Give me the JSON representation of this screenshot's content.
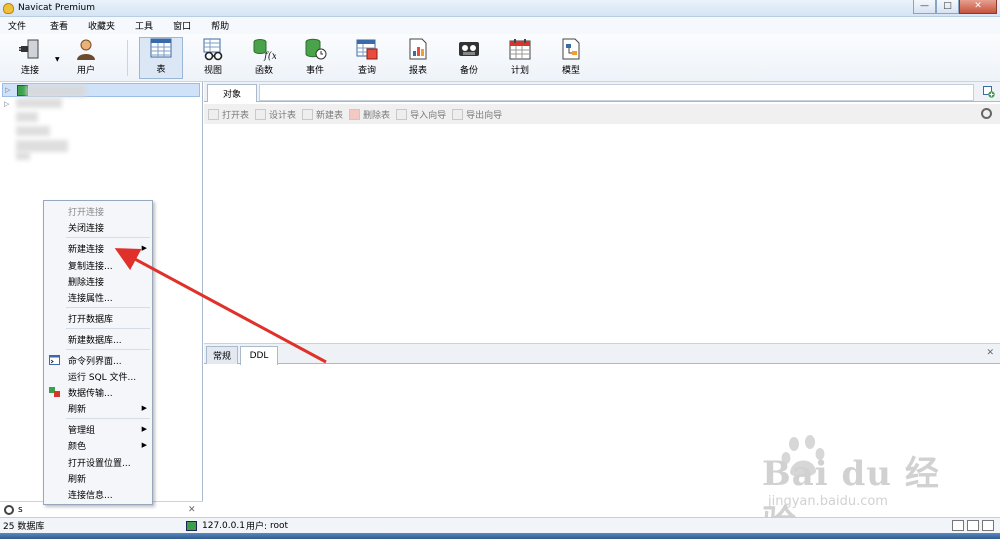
{
  "window": {
    "title": "Navicat Premium"
  },
  "menubar": {
    "items": [
      "文件",
      "查看",
      "收藏夹",
      "工具",
      "窗口",
      "帮助"
    ]
  },
  "toolbar": {
    "buttons": [
      {
        "label": "连接",
        "icon": "plug-icon"
      },
      {
        "label": "用户",
        "icon": "user-icon"
      },
      {
        "label": "表",
        "icon": "table-icon"
      },
      {
        "label": "视图",
        "icon": "view-icon"
      },
      {
        "label": "函数",
        "icon": "function-icon"
      },
      {
        "label": "事件",
        "icon": "event-icon"
      },
      {
        "label": "查询",
        "icon": "query-icon"
      },
      {
        "label": "报表",
        "icon": "report-icon"
      },
      {
        "label": "备份",
        "icon": "backup-icon"
      },
      {
        "label": "计划",
        "icon": "schedule-icon"
      },
      {
        "label": "模型",
        "icon": "model-icon"
      }
    ],
    "active": "表"
  },
  "objects_tab": {
    "label": "对象"
  },
  "object_toolbar": {
    "buttons": [
      "打开表",
      "设计表",
      "新建表",
      "删除表",
      "导入向导",
      "导出向导"
    ]
  },
  "context_menu": {
    "items": [
      {
        "label": "打开连接",
        "disabled": true
      },
      {
        "label": "关闭连接"
      },
      {
        "label": "新建连接",
        "submenu": true
      },
      {
        "label": "复制连接..."
      },
      {
        "label": "删除连接"
      },
      {
        "label": "连接属性..."
      },
      {
        "label": "打开数据库"
      },
      {
        "label": "新建数据库..."
      },
      {
        "label": "命令列界面...",
        "icon": "console-icon"
      },
      {
        "label": "运行 SQL 文件..."
      },
      {
        "label": "数据传输...",
        "icon": "transfer-icon"
      },
      {
        "label": "刷新",
        "submenu": true
      },
      {
        "label": "管理组",
        "submenu": true
      },
      {
        "label": "颜色",
        "submenu": true
      },
      {
        "label": "打开设置位置..."
      },
      {
        "label": "刷新"
      },
      {
        "label": "连接信息..."
      }
    ]
  },
  "nav_search": {
    "value": "s"
  },
  "bottom_tabs": {
    "items": [
      "常规",
      "DDL"
    ],
    "active": "DDL"
  },
  "watermark": {
    "brand": "Bai du 经验",
    "url": "jingyan.baidu.com"
  },
  "statusbar": {
    "db_count": "25 数据库",
    "host": "127.0.0.1",
    "user_label": "用户:",
    "user": "root"
  },
  "annotation": {
    "arrow_color": "#e0302a"
  }
}
